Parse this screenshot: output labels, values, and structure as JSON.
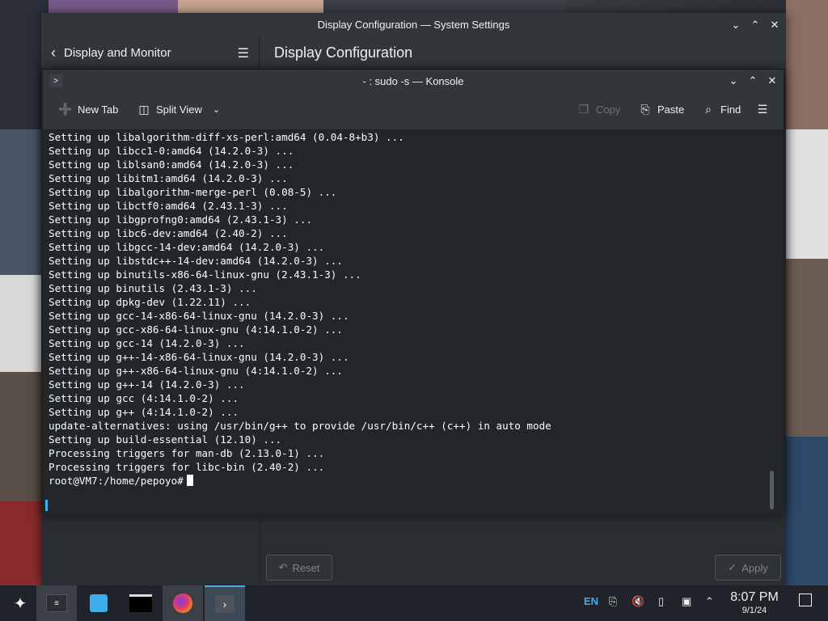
{
  "settings": {
    "title": "Display Configuration — System Settings",
    "sidebar_title": "Display and Monitor",
    "page_title": "Display Configuration",
    "reset_label": "Reset",
    "apply_label": "Apply"
  },
  "konsole": {
    "title": "- : sudo -s — Konsole",
    "toolbar": {
      "new_tab": "New Tab",
      "split_view": "Split View",
      "copy": "Copy",
      "paste": "Paste",
      "find": "Find"
    },
    "lines": [
      "Setting up libalgorithm-diff-xs-perl:amd64 (0.04-8+b3) ...",
      "Setting up libcc1-0:amd64 (14.2.0-3) ...",
      "Setting up liblsan0:amd64 (14.2.0-3) ...",
      "Setting up libitm1:amd64 (14.2.0-3) ...",
      "Setting up libalgorithm-merge-perl (0.08-5) ...",
      "Setting up libctf0:amd64 (2.43.1-3) ...",
      "Setting up libgprofng0:amd64 (2.43.1-3) ...",
      "Setting up libc6-dev:amd64 (2.40-2) ...",
      "Setting up libgcc-14-dev:amd64 (14.2.0-3) ...",
      "Setting up libstdc++-14-dev:amd64 (14.2.0-3) ...",
      "Setting up binutils-x86-64-linux-gnu (2.43.1-3) ...",
      "Setting up binutils (2.43.1-3) ...",
      "Setting up dpkg-dev (1.22.11) ...",
      "Setting up gcc-14-x86-64-linux-gnu (14.2.0-3) ...",
      "Setting up gcc-x86-64-linux-gnu (4:14.1.0-2) ...",
      "Setting up gcc-14 (14.2.0-3) ...",
      "Setting up g++-14-x86-64-linux-gnu (14.2.0-3) ...",
      "Setting up g++-x86-64-linux-gnu (4:14.1.0-2) ...",
      "Setting up g++-14 (14.2.0-3) ...",
      "Setting up gcc (4:14.1.0-2) ...",
      "Setting up g++ (4:14.1.0-2) ...",
      "update-alternatives: using /usr/bin/g++ to provide /usr/bin/c++ (c++) in auto mode",
      "Setting up build-essential (12.10) ...",
      "Processing triggers for man-db (2.13.0-1) ...",
      "Processing triggers for libc-bin (2.40-2) ..."
    ],
    "prompt": "root@VM7:/home/pepoyo#"
  },
  "taskbar": {
    "language": "EN",
    "time": "8:07 PM",
    "date": "9/1/24"
  },
  "colors": {
    "accent": "#3daee9",
    "window_bg": "#31363b",
    "terminal_bg": "#232629"
  }
}
